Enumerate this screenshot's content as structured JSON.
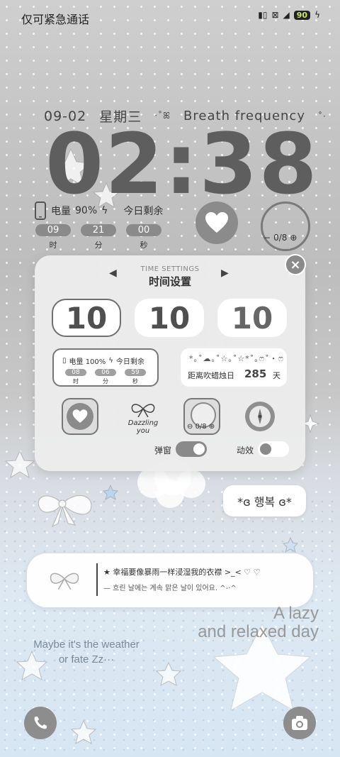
{
  "status_bar": {
    "emergency_text": "仅可紧急通话",
    "battery": "90"
  },
  "date_line": {
    "date": "09-02",
    "weekday": "星期三",
    "title": "Breath frequency"
  },
  "clock": {
    "time": "02:38"
  },
  "battery_widget": {
    "label": "电量",
    "percent": "90%",
    "remain_label": "今日剩余",
    "hours": "09",
    "minutes": "21",
    "seconds": "00",
    "hours_label": "时",
    "minutes_label": "分",
    "seconds_label": "秒"
  },
  "water_counter": {
    "text": "0/8"
  },
  "time_settings": {
    "title_en": "TIME SETTINGS",
    "title_cn": "时间设置",
    "values": [
      "10",
      "10",
      "10"
    ]
  },
  "preview_battery": {
    "text": "电量 100%",
    "remain": "今日剩余",
    "hours": "08",
    "minutes": "06",
    "seconds": "59",
    "hours_label": "时",
    "minutes_label": "分",
    "seconds_label": "秒"
  },
  "preview_countdown": {
    "deco": "*｡˚☁︎｡˚☆｡˚☆*˚｡ෆ˚・ෆ",
    "label": "距离吹蜡烛日",
    "days": "285",
    "unit": "天"
  },
  "preview_bow": {
    "text": "Dazzling you"
  },
  "preview_counter": {
    "text": "0/8"
  },
  "toggles": {
    "popup_label": "弹窗",
    "animation_label": "动效"
  },
  "bubble": {
    "text": "*ɞ 행복 ɞ*"
  },
  "quote_card": {
    "line1": "★ 幸福要像暴雨一样浸湿我的衣襟 >_< ♡ ♡",
    "line2": "— 흐린 날에는 계속 맑은 날이 있어요. ^-·^"
  },
  "lazy_text": {
    "line1": "A lazy",
    "line2": "and relaxed day"
  },
  "maybe_text": {
    "line1": "Maybe it's the weather",
    "line2": "or fate Zz···"
  }
}
